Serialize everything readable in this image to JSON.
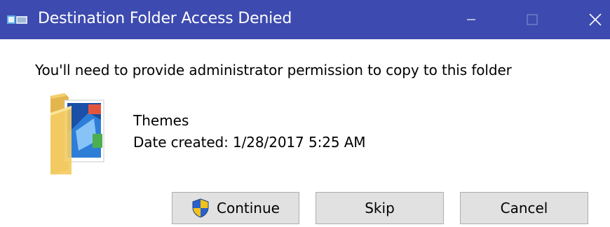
{
  "window": {
    "title": "Destination Folder Access Denied",
    "titlebar_color": "#3d4aaf",
    "controls": [
      "minimize-icon",
      "maximize-icon",
      "close-icon"
    ]
  },
  "message": "You'll need to provide administrator permission to copy to this folder",
  "item": {
    "icon": "folder-icon",
    "name": "Themes",
    "date_created": "Date created: 1/28/2017 5:25 AM"
  },
  "buttons": {
    "continue_label": "Continue",
    "continue_icon": "uac-shield-icon",
    "skip_label": "Skip",
    "cancel_label": "Cancel"
  }
}
